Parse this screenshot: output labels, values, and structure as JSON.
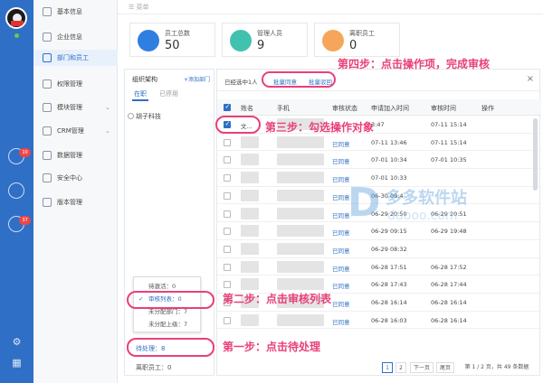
{
  "topbar": {
    "menu_label": "☰ 菜单"
  },
  "rail": {
    "badges": [
      "10",
      "37"
    ]
  },
  "nav": [
    {
      "label": "基本信息",
      "chev": ""
    },
    {
      "label": "企业信息",
      "chev": ""
    },
    {
      "label": "部门和员工",
      "chev": "",
      "active": true
    },
    {
      "label": "权限管理",
      "chev": ""
    },
    {
      "label": "模块管理",
      "chev": "⌄"
    },
    {
      "label": "CRM管理",
      "chev": "⌄"
    },
    {
      "label": "数据管理",
      "chev": ""
    },
    {
      "label": "安全中心",
      "chev": ""
    },
    {
      "label": "版本管理",
      "chev": ""
    }
  ],
  "cards": [
    {
      "label": "员工总数",
      "value": "50",
      "color": "#2f7fe0"
    },
    {
      "label": "管理人员",
      "value": "9",
      "color": "#41c2b0"
    },
    {
      "label": "离职员工",
      "value": "0",
      "color": "#f5a65b"
    }
  ],
  "org": {
    "title": "组织架构",
    "add": "+添加部门",
    "tab_active": "在职",
    "tab_other": "已停用",
    "node": "胡子科技",
    "popup": [
      "待激活：0",
      "审核列表：0",
      "未分配部门：7",
      "未分配上级：7"
    ],
    "pending": "待处理：8",
    "resigned": "离职员工：0"
  },
  "list": {
    "selected": "已经选中1人",
    "approve": "批量同意",
    "reject": "批量驳回",
    "close": "×",
    "headers": [
      "姓名",
      "手机",
      "审核状态",
      "申请加入时间",
      "审核时间",
      "操作"
    ],
    "rows": [
      {
        "name": "文...",
        "status": "",
        "apply": "3:47",
        "review": "07-11 15:14",
        "checked": true
      },
      {
        "name": "",
        "status": "已同意",
        "apply": "07-11 13:46",
        "review": "07-11 15:14",
        "checked": false
      },
      {
        "name": "",
        "status": "已同意",
        "apply": "07-01 10:34",
        "review": "07-01 10:35",
        "checked": false
      },
      {
        "name": "",
        "status": "已同意",
        "apply": "07-01 10:33",
        "review": "",
        "checked": false
      },
      {
        "name": "",
        "status": "已同意",
        "apply": "06-30 09:4",
        "review": "",
        "checked": false
      },
      {
        "name": "",
        "status": "已同意",
        "apply": "06-29 20:50",
        "review": "06-29 20:51",
        "checked": false
      },
      {
        "name": "",
        "status": "已同意",
        "apply": "06-29 09:15",
        "review": "06-29 19:48",
        "checked": false
      },
      {
        "name": "",
        "status": "已同意",
        "apply": "06-29 08:32",
        "review": "",
        "checked": false
      },
      {
        "name": "",
        "status": "已同意",
        "apply": "06-28 17:51",
        "review": "06-28 17:52",
        "checked": false
      },
      {
        "name": "",
        "status": "已同意",
        "apply": "06-28 17:43",
        "review": "06-28 17:44",
        "checked": false
      },
      {
        "name": "",
        "status": "已同意",
        "apply": "06-28 16:14",
        "review": "06-28 16:14",
        "checked": false
      },
      {
        "name": "",
        "status": "已同意",
        "apply": "06-28 16:03",
        "review": "06-28 16:14",
        "checked": false
      }
    ],
    "pager": [
      "1",
      "2",
      "下一页",
      "尾页",
      "第 1 / 2 页，共 49 条数据"
    ]
  },
  "annotations": {
    "step1": "第一步：点击待处理",
    "step2": "第二步：点击审核列表",
    "step3": "第三步：勾选操作对象",
    "step4": "第四步：点击操作项，完成审核",
    "color": "#e8407a"
  },
  "watermark": {
    "title": "多多软件站",
    "url": "ddooo.com"
  }
}
